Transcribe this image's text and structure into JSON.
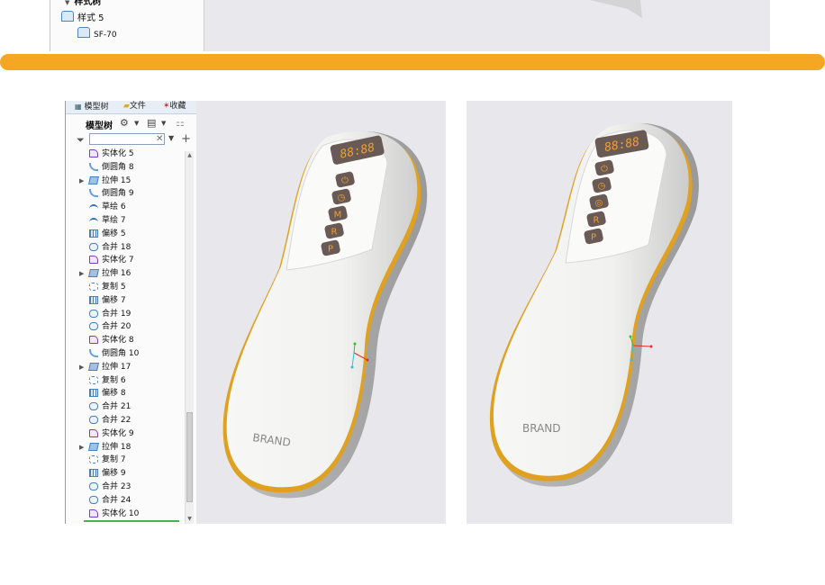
{
  "top_tree": {
    "items": [
      {
        "label": "样式树"
      },
      {
        "label": "样式 5"
      },
      {
        "label": "SF-70"
      }
    ]
  },
  "model_tree": {
    "tabs": [
      "模型树",
      "文件",
      "收藏"
    ],
    "title": "模型树",
    "filter_placeholder": "",
    "items": [
      {
        "label": "实体化 5",
        "icon": "solidify-icon",
        "expandable": false
      },
      {
        "label": "倒圆角 8",
        "icon": "round-icon",
        "expandable": false
      },
      {
        "label": "拉伸 15",
        "icon": "extrude-icon",
        "expandable": true
      },
      {
        "label": "倒圆角 9",
        "icon": "round-icon",
        "expandable": false
      },
      {
        "label": "草绘 6",
        "icon": "sketch-icon",
        "expandable": false
      },
      {
        "label": "草绘 7",
        "icon": "sketch-icon",
        "expandable": false
      },
      {
        "label": "偏移 5",
        "icon": "offset-icon",
        "expandable": false
      },
      {
        "label": "合并 18",
        "icon": "merge-icon",
        "expandable": false
      },
      {
        "label": "实体化 7",
        "icon": "solidify-icon",
        "expandable": false
      },
      {
        "label": "拉伸 16",
        "icon": "extrude-icon",
        "expandable": true
      },
      {
        "label": "复制 5",
        "icon": "copy-icon",
        "expandable": false
      },
      {
        "label": "偏移 7",
        "icon": "offset-icon",
        "expandable": false
      },
      {
        "label": "合并 19",
        "icon": "merge-icon",
        "expandable": false
      },
      {
        "label": "合并 20",
        "icon": "merge-icon",
        "expandable": false
      },
      {
        "label": "实体化 8",
        "icon": "solidify-icon",
        "expandable": false
      },
      {
        "label": "倒圆角 10",
        "icon": "round-icon",
        "expandable": false
      },
      {
        "label": "拉伸 17",
        "icon": "extrude-icon",
        "expandable": true
      },
      {
        "label": "复制 6",
        "icon": "copy-icon",
        "expandable": false
      },
      {
        "label": "偏移 8",
        "icon": "offset-icon",
        "expandable": false
      },
      {
        "label": "合并 21",
        "icon": "merge-icon",
        "expandable": false
      },
      {
        "label": "合并 22",
        "icon": "merge-icon",
        "expandable": false
      },
      {
        "label": "实体化 9",
        "icon": "solidify-icon",
        "expandable": false
      },
      {
        "label": "拉伸 18",
        "icon": "extrude-icon",
        "expandable": true
      },
      {
        "label": "复制 7",
        "icon": "copy-icon",
        "expandable": false
      },
      {
        "label": "偏移 9",
        "icon": "offset-icon",
        "expandable": false
      },
      {
        "label": "合并 23",
        "icon": "merge-icon",
        "expandable": false
      },
      {
        "label": "合并 24",
        "icon": "merge-icon",
        "expandable": false
      },
      {
        "label": "实体化 10",
        "icon": "solidify-icon",
        "expandable": false
      }
    ]
  },
  "device": {
    "display_text": "88:88",
    "brand_text": "BRAND",
    "button_glyphs": [
      "⏻",
      "◷",
      "M",
      "R",
      "P"
    ],
    "button_glyphs_view2": [
      "⏻",
      "◷",
      "◎",
      "R",
      "P"
    ]
  },
  "colors": {
    "accent_orange": "#f5a623",
    "device_rim": "#e0a020",
    "device_body": "#f4f4f2",
    "viewport_bg": "#e7e7ec",
    "display_text": "#f0a030"
  }
}
